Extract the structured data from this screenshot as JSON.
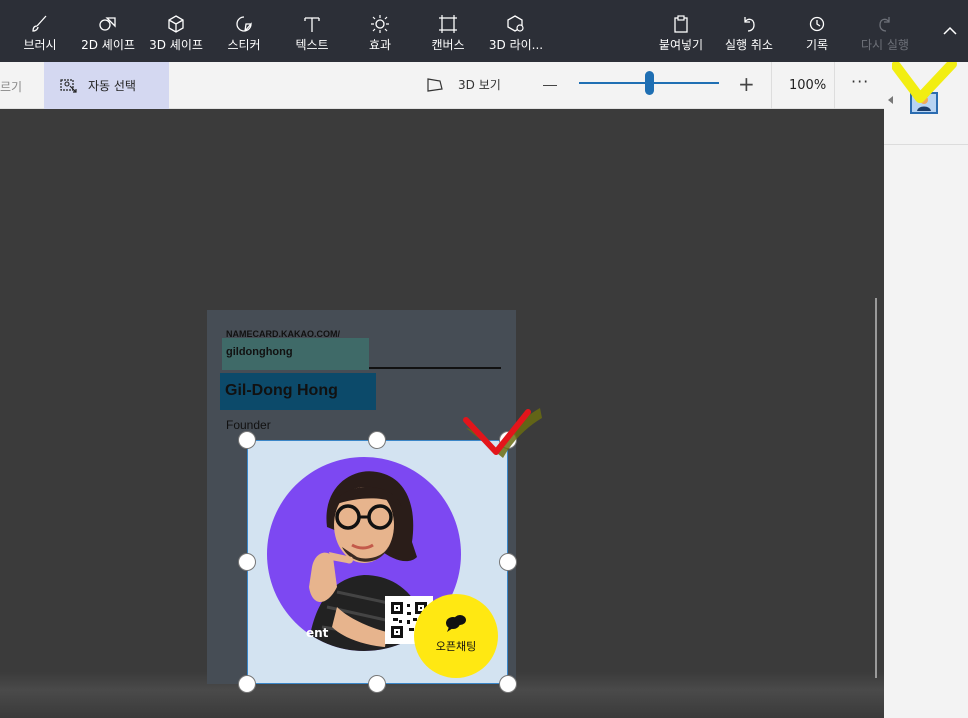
{
  "toolbar": {
    "tools": [
      {
        "label": "브러시",
        "icon": "brush-icon"
      },
      {
        "label": "2D 셰이프",
        "icon": "2d-shapes-icon"
      },
      {
        "label": "3D 셰이프",
        "icon": "3d-shapes-icon"
      },
      {
        "label": "스티커",
        "icon": "sticker-icon"
      },
      {
        "label": "텍스트",
        "icon": "text-icon"
      },
      {
        "label": "효과",
        "icon": "effects-icon"
      },
      {
        "label": "캔버스",
        "icon": "canvas-icon"
      },
      {
        "label": "3D 라이...",
        "icon": "3d-library-icon"
      }
    ],
    "actions": [
      {
        "label": "붙여넣기",
        "icon": "paste-icon"
      },
      {
        "label": "실행 취소",
        "icon": "undo-icon"
      },
      {
        "label": "기록",
        "icon": "history-icon"
      },
      {
        "label": "다시 실행",
        "icon": "redo-icon",
        "disabled": true
      }
    ]
  },
  "subbar": {
    "cut_label": "르기",
    "auto_select_label": "자동 선택",
    "view3d_label": "3D 보기",
    "zoom_level": 0.5,
    "zoom_percent": "100%",
    "more_label": "···"
  },
  "card": {
    "url": "NAMECARD.KAKAO.COM/",
    "handle": "gildonghong",
    "name": "Gil-Dong Hong",
    "role": "Founder",
    "ent_text": "ent",
    "openchat_label": "오픈채팅"
  },
  "colors": {
    "toolbar_bg": "#2c2f37",
    "accent": "#1f6fb3",
    "selection_fill": "#d3e3f1",
    "avatar_bg": "#7d48f2",
    "openchat_yellow": "#ffe812",
    "annotation_red": "#e3151b",
    "annotation_yellow": "#f2ee12"
  }
}
